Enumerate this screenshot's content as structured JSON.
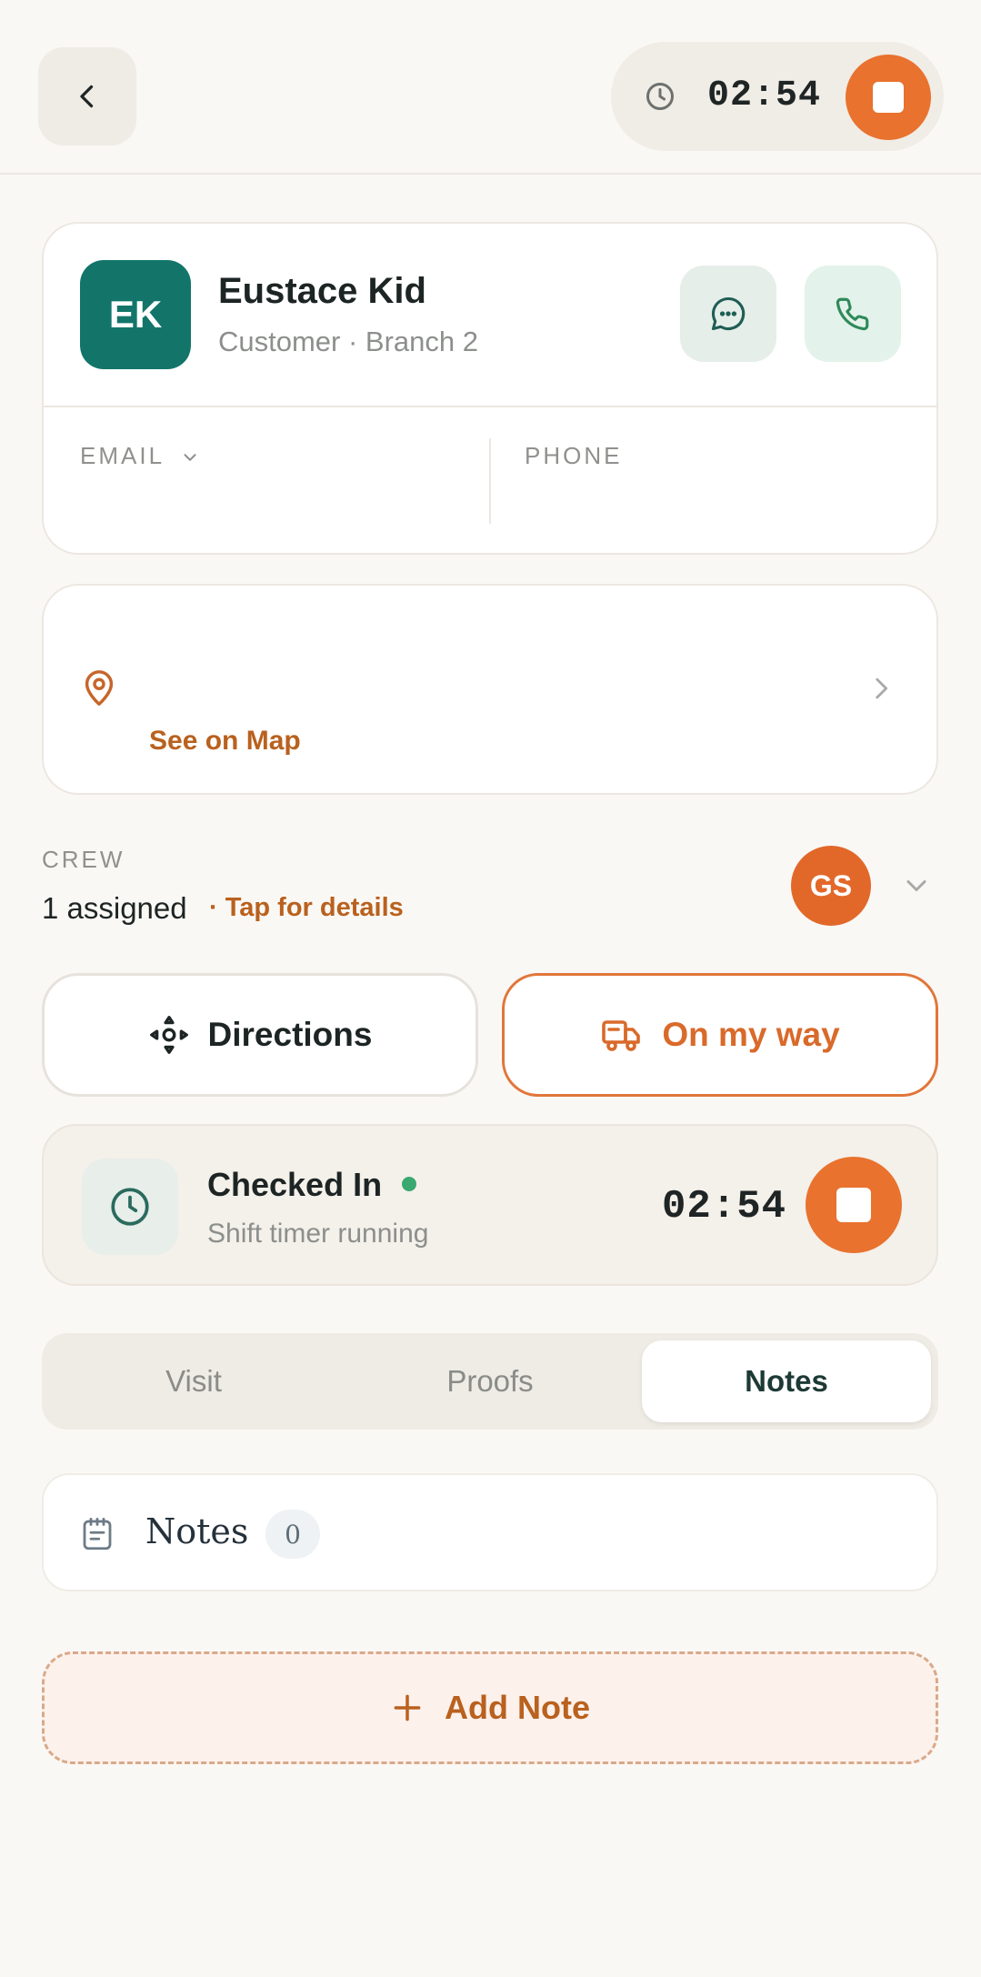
{
  "header": {
    "timer": "02:54"
  },
  "customer": {
    "initials": "EK",
    "name": "Eustace Kid",
    "subtitle": "Customer · Branch 2",
    "email_label": "EMAIL",
    "phone_label": "PHONE"
  },
  "location": {
    "map_link": "See on Map"
  },
  "crew": {
    "label": "CREW",
    "count": "1 assigned",
    "details_link": "· Tap for details",
    "member_initials": "GS"
  },
  "actions": {
    "directions": "Directions",
    "on_my_way": "On my way"
  },
  "checkin": {
    "title": "Checked In",
    "subtitle": "Shift timer running",
    "timer": "02:54"
  },
  "tabs": [
    {
      "label": "Visit",
      "active": false
    },
    {
      "label": "Proofs",
      "active": false
    },
    {
      "label": "Notes",
      "active": true
    }
  ],
  "notes": {
    "title": "Notes",
    "count": "0",
    "add_label": "Add Note"
  },
  "colors": {
    "accent": "#e8722e",
    "brand_teal": "#13756a",
    "link": "#b9611e",
    "status_green": "#3aa86f"
  }
}
